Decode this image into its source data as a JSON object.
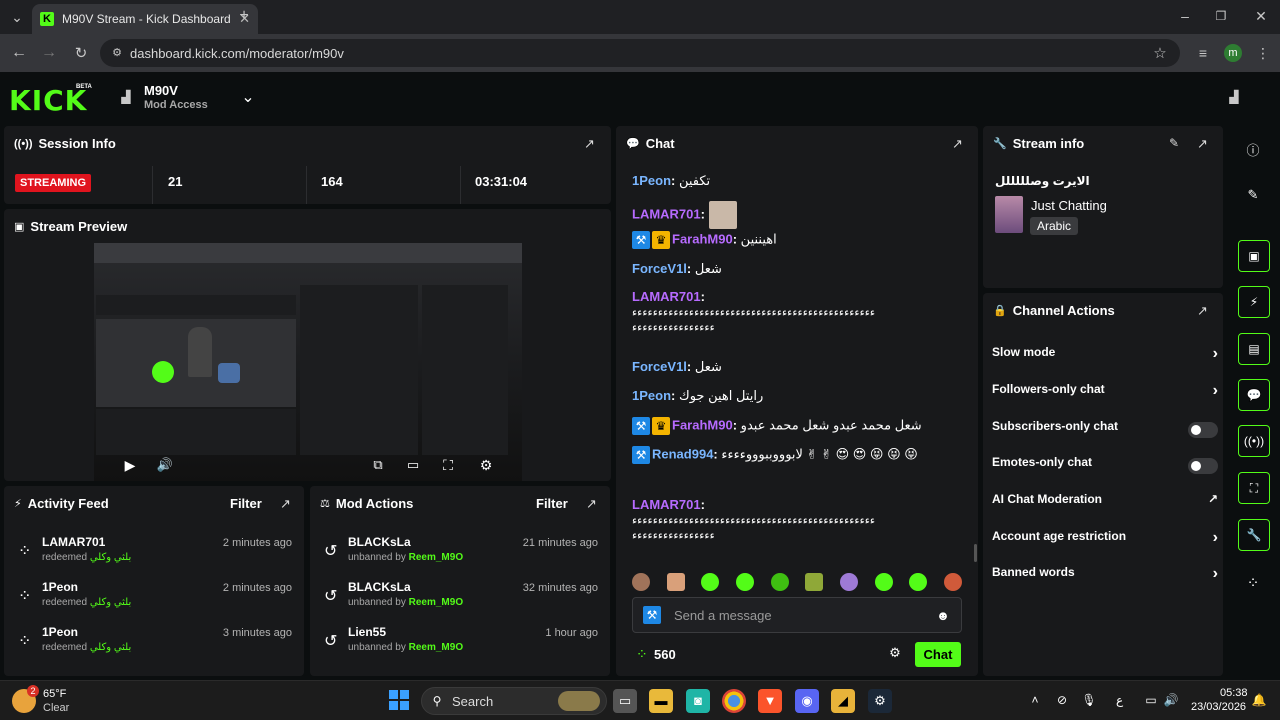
{
  "browser": {
    "tab_title": "M90V Stream - Kick Dashboard",
    "url": "dashboard.kick.com/moderator/m90v",
    "profile_initial": "m"
  },
  "header": {
    "logo": "KICK",
    "beta": "BETA",
    "channel_name": "M90V",
    "access": "Mod Access"
  },
  "session_info": {
    "title": "Session Info",
    "status": "STREAMING",
    "viewers": "21",
    "followers": "164",
    "time_live": "03:31:04"
  },
  "stream_preview": {
    "title": "Stream Preview"
  },
  "activity_feed": {
    "title": "Activity Feed",
    "filter": "Filter",
    "items": [
      {
        "name": "LAMAR701",
        "action": "redeemed",
        "reward": "بلثي وكلي",
        "time": "2 minutes ago"
      },
      {
        "name": "1Peon",
        "action": "redeemed",
        "reward": "بلثي وكلي",
        "time": "2 minutes ago"
      },
      {
        "name": "1Peon",
        "action": "redeemed",
        "reward": "بلثي وكلي",
        "time": "3 minutes ago"
      }
    ]
  },
  "mod_actions": {
    "title": "Mod Actions",
    "filter": "Filter",
    "items": [
      {
        "name": "BLACKsLa",
        "action": "unbanned by",
        "by": "Reem_M9O",
        "time": "21 minutes ago"
      },
      {
        "name": "BLACKsLa",
        "action": "unbanned by",
        "by": "Reem_M9O",
        "time": "32 minutes ago"
      },
      {
        "name": "Lien55",
        "action": "unbanned by",
        "by": "Reem_M9O",
        "time": "1 hour ago"
      }
    ]
  },
  "chat": {
    "title": "Chat",
    "messages": [
      {
        "user": "1Peon",
        "text": "تكفين",
        "color": "blue"
      },
      {
        "user": "LAMAR701",
        "text": "",
        "color": "purple"
      },
      {
        "user": "FarahM90",
        "text": "اهيننين",
        "color": "purple"
      },
      {
        "user": "ForceV1l",
        "text": "شعل",
        "color": "blue"
      },
      {
        "user": "LAMAR701",
        "text": "ءءءءءءءءءءءءءءءءءءءءءءءءءءءءءءءءءءءءءءءءءءءءءءء",
        "text2": "ءءءءءءءءءءءءءءءء",
        "color": "purple"
      },
      {
        "user": "ForceV1l",
        "text": "شعل",
        "color": "blue"
      },
      {
        "user": "1Peon",
        "text": "رايتل اهين جوك",
        "color": "blue"
      },
      {
        "user": "FarahM90",
        "text": "شعل محمد عبدو شعل محمد عبدو",
        "color": "purple"
      },
      {
        "user": "Renad994",
        "text": "لابوووببوووءءءء ✌ ✌ 😍 😍 😝 😝 😝",
        "color": "blue"
      },
      {
        "user": "LAMAR701",
        "text": "ءءءءءءءءءءءءءءءءءءءءءءءءءءءءءءءءءءءءءءءءءءءءءءء",
        "text2": "ءءءءءءءءءءءءءءءء",
        "color": "purple"
      }
    ],
    "placeholder": "Send a message",
    "points": "560",
    "send_label": "Chat"
  },
  "stream_info": {
    "title": "Stream info",
    "stream_title": "الايرت وصلللللل",
    "category": "Just Chatting",
    "tag": "Arabic"
  },
  "channel_actions": {
    "title": "Channel Actions",
    "items": [
      {
        "label": "Slow mode",
        "control": "chevron"
      },
      {
        "label": "Followers-only chat",
        "control": "chevron"
      },
      {
        "label": "Subscribers-only chat",
        "control": "toggle"
      },
      {
        "label": "Emotes-only chat",
        "control": "toggle"
      },
      {
        "label": "AI Chat Moderation",
        "control": "external"
      },
      {
        "label": "Account age restriction",
        "control": "chevron"
      },
      {
        "label": "Banned words",
        "control": "chevron"
      }
    ]
  },
  "taskbar": {
    "weather_temp": "65°F",
    "weather_desc": "Clear",
    "weather_badge": "2",
    "search": "Search",
    "time": "05:38",
    "date": "23/03/2026",
    "lang": "ع"
  },
  "colors": {
    "brand": "#53fc18",
    "streaming": "#e0141e",
    "panel": "#18191b"
  }
}
